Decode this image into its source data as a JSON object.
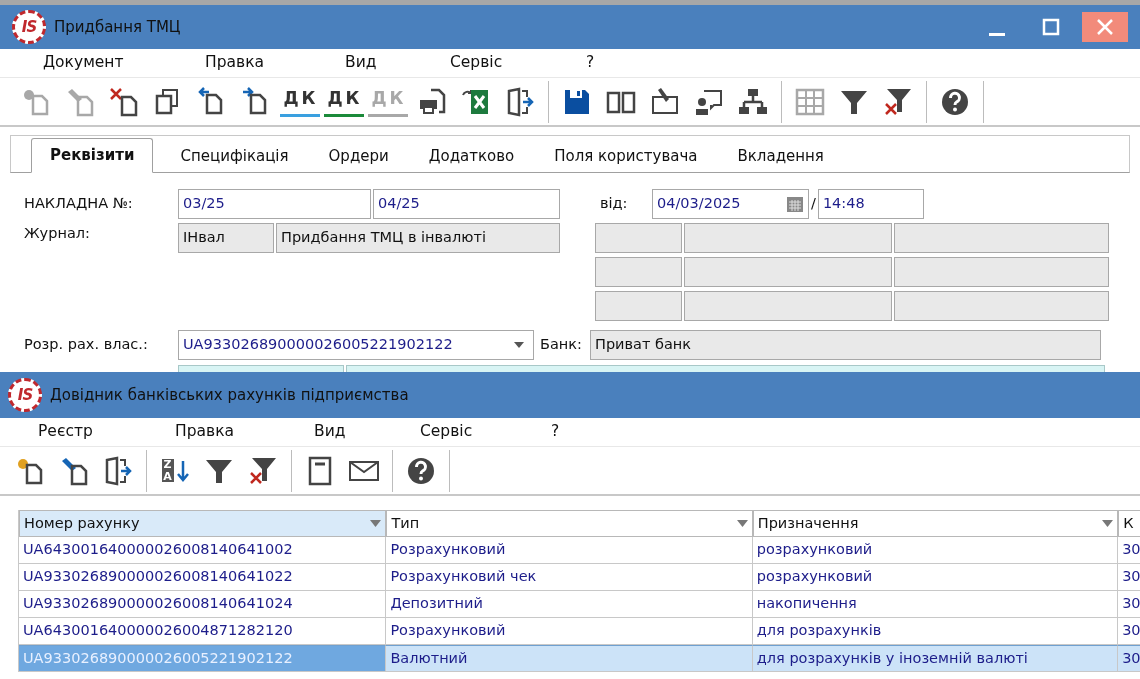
{
  "main_window": {
    "logo": "IS",
    "title": "Придбання ТМЦ",
    "menu": [
      "Документ",
      "Правка",
      "Вид",
      "Сервіс",
      "?"
    ],
    "toolbar": [
      {
        "kind": "new",
        "disabled": true
      },
      {
        "kind": "edit",
        "disabled": true
      },
      {
        "kind": "delete",
        "disabled": false
      },
      {
        "kind": "copy",
        "disabled": false
      },
      {
        "kind": "back",
        "disabled": false
      },
      {
        "kind": "forward",
        "disabled": false
      },
      {
        "kind": "dk-line",
        "letters": "ДК",
        "disabled": false
      },
      {
        "kind": "dk-up",
        "letters": "ДК",
        "disabled": false
      },
      {
        "kind": "dk-down",
        "letters": "ДК",
        "disabled": true
      },
      {
        "kind": "print",
        "disabled": false
      },
      {
        "kind": "excel",
        "disabled": false
      },
      {
        "kind": "exit",
        "disabled": false
      },
      {
        "kind": "separator"
      },
      {
        "kind": "save",
        "disabled": false
      },
      {
        "kind": "book",
        "disabled": false
      },
      {
        "kind": "edit-book",
        "disabled": false
      },
      {
        "kind": "user-chat",
        "disabled": false
      },
      {
        "kind": "hierarchy",
        "disabled": false
      },
      {
        "kind": "separator"
      },
      {
        "kind": "grid",
        "disabled": true
      },
      {
        "kind": "filter",
        "disabled": false
      },
      {
        "kind": "filter-clear",
        "disabled": false
      },
      {
        "kind": "separator"
      },
      {
        "kind": "help",
        "disabled": false
      },
      {
        "kind": "separator"
      }
    ],
    "tabs": [
      {
        "label": "Реквізити",
        "selected": true
      },
      {
        "label": "Специфікація",
        "selected": false
      },
      {
        "label": "Ордери",
        "selected": false
      },
      {
        "label": "Додатково",
        "selected": false
      },
      {
        "label": "Поля користувача",
        "selected": false
      },
      {
        "label": "Вкладення",
        "selected": false
      }
    ],
    "form": {
      "invoice_label": "НАКЛАДНА №:",
      "invoice_number": {
        "value": "03/25",
        "readonly": false
      },
      "invoice_number_2": {
        "value": "04/25",
        "readonly": false
      },
      "date_label": "від:",
      "date": {
        "value": "04/03/2025",
        "readonly": false
      },
      "date_separator": "/",
      "time": {
        "value": "14:48",
        "readonly": false
      },
      "journal_label": "Журнал:",
      "journal_code": {
        "value": "ІНвал",
        "readonly": true
      },
      "journal_name": {
        "value": "Придбання ТМЦ в інвалюті",
        "readonly": true
      },
      "account_label": "Розр. рах. влас.:",
      "account": {
        "value": "UA933026890000026005221902122",
        "readonly": false
      },
      "bank_label": "Банк:",
      "bank": {
        "value": "Приват банк",
        "readonly": true
      }
    }
  },
  "bank_accounts_window": {
    "logo": "IS",
    "title": "Довідник банківських рахунків підприємства",
    "menu": [
      "Реєстр",
      "Правка",
      "Вид",
      "Сервіс",
      "?"
    ],
    "toolbar": [
      {
        "kind": "new",
        "disabled": false
      },
      {
        "kind": "edit",
        "disabled": false
      },
      {
        "kind": "exit",
        "disabled": false
      },
      {
        "kind": "separator"
      },
      {
        "kind": "sort",
        "letters": "ZA",
        "disabled": false
      },
      {
        "kind": "filter",
        "disabled": false
      },
      {
        "kind": "filter-clear",
        "disabled": false
      },
      {
        "kind": "separator"
      },
      {
        "kind": "notebook",
        "disabled": false
      },
      {
        "kind": "mail",
        "disabled": false
      },
      {
        "kind": "separator"
      },
      {
        "kind": "help",
        "disabled": false
      },
      {
        "kind": "separator"
      }
    ],
    "table": {
      "columns": [
        {
          "label": "Номер рахунку",
          "selected": true
        },
        {
          "label": "Тип",
          "selected": false
        },
        {
          "label": "Призначення",
          "selected": false
        },
        {
          "label": "К",
          "selected": false
        }
      ],
      "rows": [
        {
          "cells": [
            "UA643001640000026008140641002",
            "Розрахунковий",
            "розрахунковий",
            "30"
          ],
          "selected": false
        },
        {
          "cells": [
            "UA933026890000026008140641022",
            "Розрахунковий чек",
            "розрахунковий",
            "30"
          ],
          "selected": false
        },
        {
          "cells": [
            "UA933026890000026008140641024",
            "Депозитний",
            "накопичення",
            "30"
          ],
          "selected": false
        },
        {
          "cells": [
            "UA643001640000026004871282120",
            "Розрахунковий",
            "для розрахунків",
            "30"
          ],
          "selected": false
        },
        {
          "cells": [
            "UA933026890000026005221902122",
            "Валютний",
            "для розрахунків у іноземній валюті",
            "30"
          ],
          "selected": true
        }
      ]
    }
  }
}
